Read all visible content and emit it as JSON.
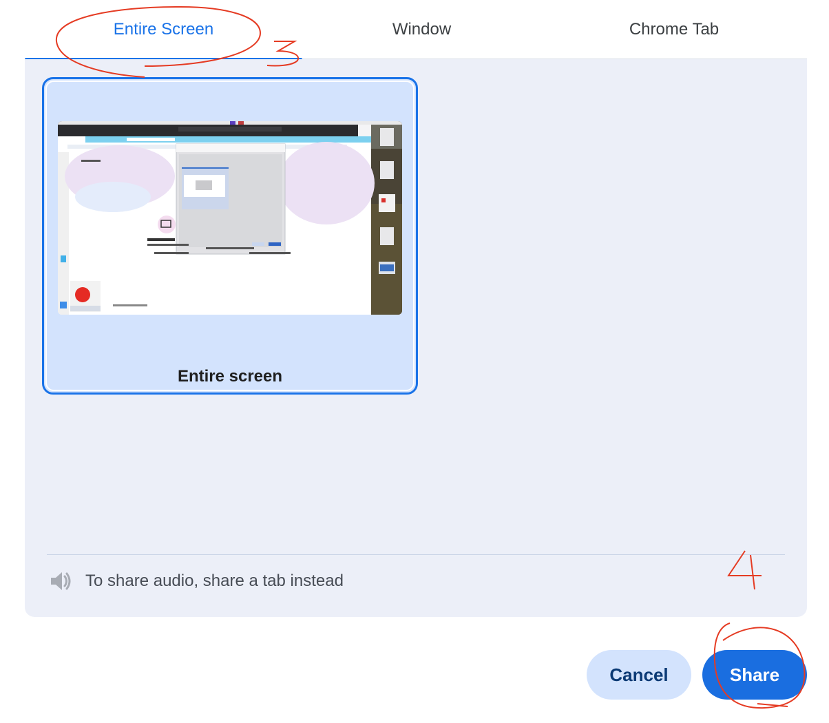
{
  "tabs": [
    {
      "label": "Entire Screen",
      "selected": true
    },
    {
      "label": "Window",
      "selected": false
    },
    {
      "label": "Chrome Tab",
      "selected": false
    }
  ],
  "source_card": {
    "label": "Entire screen",
    "selected": true
  },
  "audio_note": {
    "icon": "speaker-icon",
    "text": "To share audio, share a tab instead"
  },
  "buttons": {
    "cancel": "Cancel",
    "share": "Share"
  },
  "annotations": {
    "step_tab": "3",
    "step_share": "4"
  },
  "colors": {
    "accent": "#1a73e8",
    "panel": "#eceff8",
    "card_selected": "#d3e3fd",
    "annotation": "#e53b23"
  }
}
